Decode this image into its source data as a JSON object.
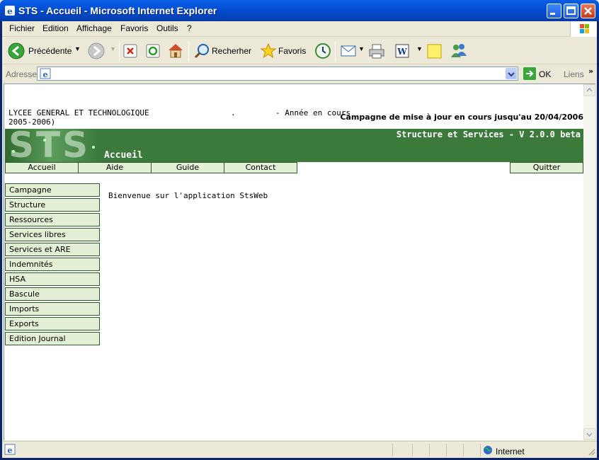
{
  "window": {
    "title": "STS - Accueil - Microsoft Internet Explorer"
  },
  "menu": [
    "Fichier",
    "Edition",
    "Affichage",
    "Favoris",
    "Outils",
    "?"
  ],
  "toolbar": {
    "back_label": "Précédente",
    "search_label": "Recherher",
    "favorites_label": "Favoris"
  },
  "address": {
    "label": "Adresse",
    "value": "",
    "go_label": "OK",
    "links_label": "Liens"
  },
  "page": {
    "school_line1": "LYCEE GENERAL ET TECHNOLOGIQUE",
    "school_dot": ".",
    "year_label": "- Année en cours",
    "school_line2": "2005-2006)",
    "campaign": "Campagne de mise à jour en cours jusqu'au 20/04/2006",
    "logo_text": "STS",
    "banner_title": "Structure et Services - V 2.0.0 beta",
    "current_page": "Accueil",
    "top_nav": [
      "Accueil",
      "Aide",
      "Guide",
      "Contact"
    ],
    "quit_label": "Quitter",
    "side_nav": [
      "Campagne",
      "Structure",
      "Ressources",
      "Services libres",
      "Services et ARE",
      "Indemnités",
      "HSA",
      "Bascule",
      "Imports",
      "Exports",
      "Edition Journal"
    ],
    "welcome": "Bienvenue sur l'application StsWeb"
  },
  "status": {
    "zone": "Internet"
  },
  "colors": {
    "banner": "#3c7a3c",
    "nav_bg": "#e4f0d6",
    "nav_border": "#2c5a2c",
    "xp_title": "#0450d6"
  }
}
